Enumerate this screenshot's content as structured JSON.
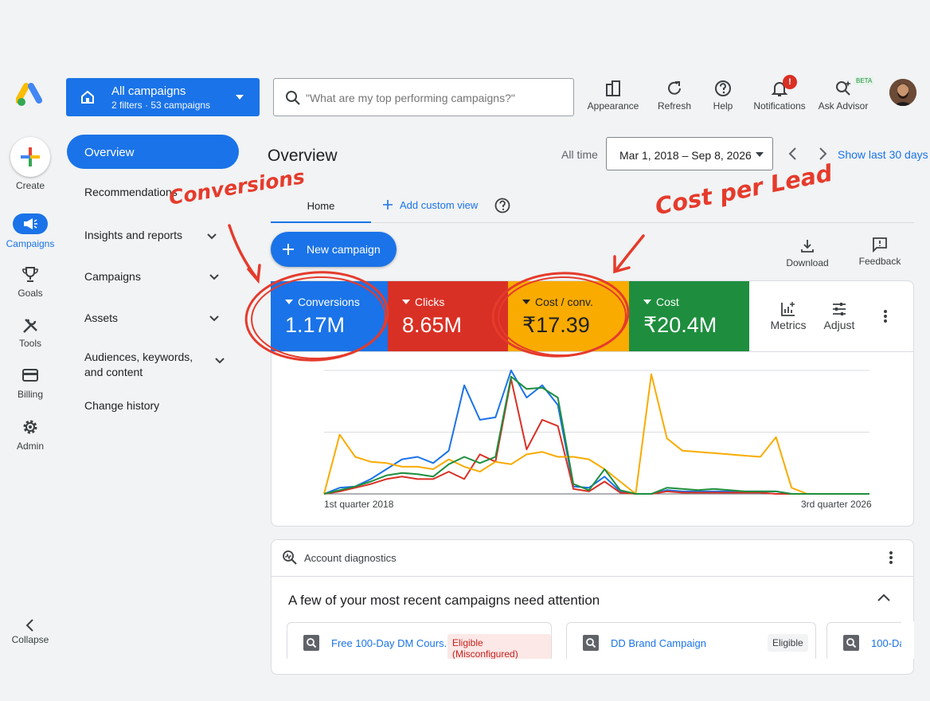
{
  "rail": {
    "create": "Create",
    "campaigns": "Campaigns",
    "goals": "Goals",
    "tools": "Tools",
    "billing": "Billing",
    "admin": "Admin",
    "collapse": "Collapse"
  },
  "account": {
    "title": "All campaigns",
    "subtitle": "2 filters · 53 campaigns"
  },
  "search": {
    "placeholder": "\"What are my top performing campaigns?\""
  },
  "toolbar": {
    "appearance": "Appearance",
    "refresh": "Refresh",
    "help": "Help",
    "notifications": "Notifications",
    "notifications_badge": "!",
    "ask_advisor": "Ask Advisor",
    "beta": "BETA"
  },
  "sidenav": {
    "overview": "Overview",
    "recommendations": "Recommendations",
    "insights": "Insights and reports",
    "campaigns": "Campaigns",
    "assets": "Assets",
    "audiences": "Audiences, keywords, and content",
    "change_history": "Change history"
  },
  "overview": {
    "title": "Overview",
    "all_time": "All time",
    "date_range": "Mar 1, 2018 – Sep 8, 2026",
    "show_last_30": "Show last 30 days",
    "tab_home": "Home",
    "add_custom_view": "Add custom view",
    "new_campaign": "New campaign",
    "download": "Download",
    "feedback": "Feedback"
  },
  "metrics": [
    {
      "name": "Conversions",
      "value": "1.17M",
      "color": "#1a73e8"
    },
    {
      "name": "Clicks",
      "value": "8.65M",
      "color": "#d93025"
    },
    {
      "name": "Cost / conv.",
      "value": "₹17.39",
      "color": "#f9ab00"
    },
    {
      "name": "Cost",
      "value": "₹20.4M",
      "color": "#1e8e3e"
    }
  ],
  "metric_tools": {
    "metrics": "Metrics",
    "adjust": "Adjust"
  },
  "chart_data": {
    "type": "line",
    "x_start_label": "1st quarter 2018",
    "x_end_label": "3rd quarter 2026",
    "ylim": [
      0,
      100
    ],
    "grid": true,
    "series": [
      {
        "color": "#1a73e8",
        "values": [
          0,
          5,
          6,
          12,
          20,
          28,
          30,
          25,
          35,
          88,
          60,
          62,
          100,
          78,
          88,
          72,
          6,
          5,
          14,
          2,
          0,
          0,
          3,
          2,
          2,
          2,
          2,
          2,
          2,
          2,
          0,
          0,
          0,
          0,
          0,
          0
        ]
      },
      {
        "color": "#d93025",
        "values": [
          0,
          2,
          5,
          8,
          12,
          14,
          12,
          12,
          18,
          12,
          32,
          26,
          93,
          36,
          60,
          55,
          4,
          2,
          10,
          1,
          0,
          0,
          2,
          1,
          1,
          1,
          1,
          1,
          1,
          0,
          0,
          0,
          0,
          0,
          0,
          0
        ]
      },
      {
        "color": "#f9ab00",
        "values": [
          0,
          48,
          30,
          26,
          25,
          22,
          22,
          20,
          28,
          22,
          18,
          26,
          24,
          32,
          34,
          30,
          30,
          28,
          20,
          10,
          0,
          97,
          45,
          35,
          34,
          33,
          32,
          31,
          30,
          46,
          5,
          0,
          0,
          0,
          0,
          0
        ]
      },
      {
        "color": "#1e8e3e",
        "values": [
          0,
          3,
          6,
          10,
          15,
          17,
          16,
          14,
          24,
          30,
          25,
          30,
          95,
          85,
          86,
          78,
          8,
          3,
          20,
          3,
          0,
          0,
          5,
          4,
          3,
          4,
          3,
          2,
          2,
          2,
          0,
          0,
          0,
          0,
          0,
          0
        ]
      }
    ]
  },
  "diagnostics": {
    "header": "Account diagnostics",
    "attention": "A few of your most recent campaigns need attention",
    "campaigns": [
      {
        "name": "Free 100-Day DM Cours...",
        "status": "Eligible (Misconfigured)"
      },
      {
        "name": "DD Brand Campaign",
        "status": "Eligible"
      },
      {
        "name": "100-Da",
        "status": ""
      }
    ]
  },
  "annotations": {
    "conversions": "Conversions",
    "cost_per_lead": "Cost per Lead"
  }
}
